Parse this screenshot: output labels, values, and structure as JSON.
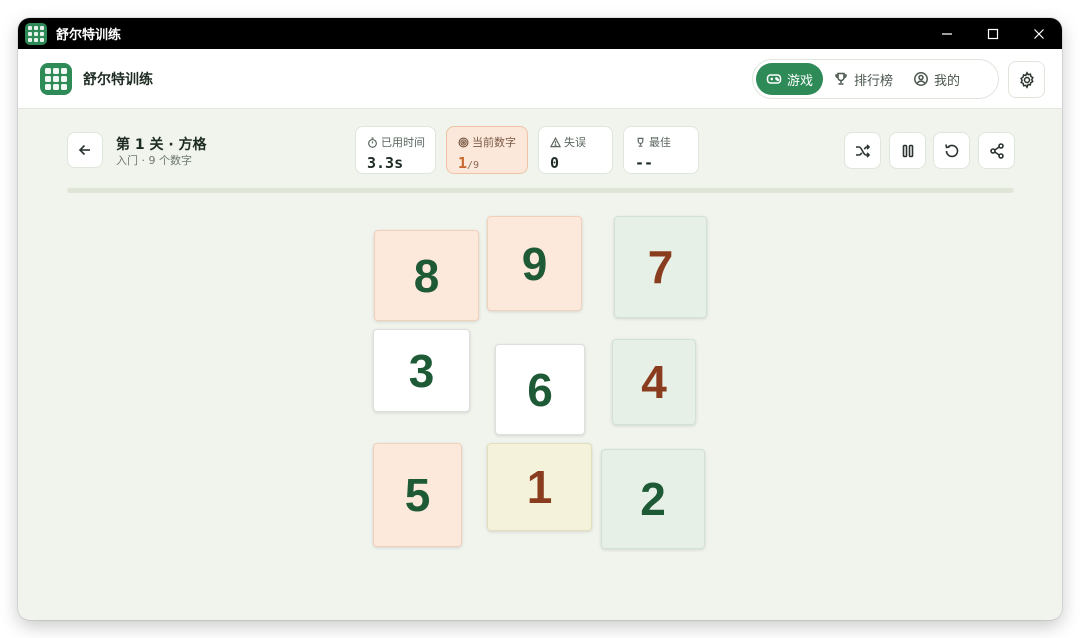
{
  "window": {
    "title": "舒尔特训练"
  },
  "appbar": {
    "app_name": "舒尔特训练",
    "nav": [
      {
        "label": "游戏",
        "icon": "gamepad-icon",
        "active": true
      },
      {
        "label": "排行榜",
        "icon": "trophy-icon",
        "active": false
      },
      {
        "label": "我的",
        "icon": "user-circle-icon",
        "active": false
      }
    ]
  },
  "level": {
    "title": "第 1 关 · 方格",
    "subtitle": "入门 · 9 个数字"
  },
  "stats": {
    "elapsed_label": "已用时间",
    "elapsed_value": "3.3s",
    "current_label": "当前数字",
    "current_value": "1",
    "current_total": "/9",
    "errors_label": "失误",
    "errors_value": "0",
    "best_label": "最佳",
    "best_value": "--"
  },
  "progress": {
    "fraction": 0
  },
  "tiles": [
    "8",
    "9",
    "7",
    "3",
    "6",
    "4",
    "5",
    "1",
    "2"
  ],
  "colors": {
    "accent": "#2e8b57",
    "peach": "#fde9dc",
    "mint": "#e6f0e6",
    "cream": "#f4f2da",
    "num_green": "#1f5a36",
    "num_brown": "#8a3d1e"
  }
}
